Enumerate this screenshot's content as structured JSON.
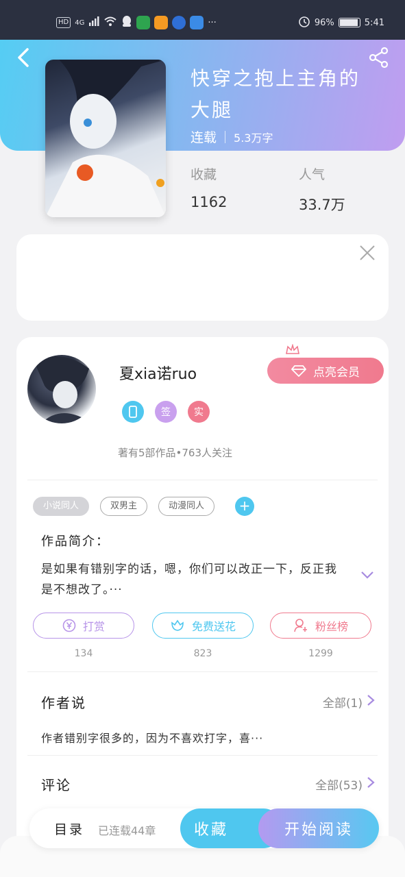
{
  "status_bar": {
    "hd": "HD",
    "network": "4G",
    "more": "···",
    "battery_text": "96%",
    "battery_level": 0.96,
    "time": "5:41"
  },
  "book": {
    "title": "快穿之抱上主角的大腿",
    "status": "连载",
    "word_count": "5.3万字",
    "collect_label": "收藏",
    "collect_value": "1162",
    "popularity_label": "人气",
    "popularity_value": "33.7万"
  },
  "author": {
    "name": "夏xia诺ruo",
    "badges": [
      {
        "icon": "phone-badge-icon",
        "text": "",
        "color": "#4fc7ef"
      },
      {
        "icon": "sign-badge-icon",
        "text": "签",
        "color": "#c9a0ee"
      },
      {
        "icon": "real-badge-icon",
        "text": "实",
        "color": "#f07a8e"
      }
    ],
    "stats": "著有5部作品•763人关注",
    "vip_label": "点亮会员"
  },
  "tags": [
    "小说同人",
    "双男主",
    "动漫同人"
  ],
  "intro": {
    "title": "作品简介：",
    "text": "是如果有错别字的话，嗯，你们可以改正一下，反正我是不想改了。···"
  },
  "actions": [
    {
      "label": "打赏",
      "count": "134",
      "color": "#b794e8",
      "icon": "yen-icon"
    },
    {
      "label": "免费送花",
      "count": "823",
      "color": "#4fc7ef",
      "icon": "flower-icon"
    },
    {
      "label": "粉丝榜",
      "count": "1299",
      "color": "#f07a8e",
      "icon": "fan-icon"
    }
  ],
  "author_says": {
    "title": "作者说",
    "more": "全部(1)",
    "text": "作者错别字很多的，因为不喜欢打字，喜···"
  },
  "comments": {
    "title": "评论",
    "more": "全部(53)"
  },
  "bottom": {
    "toc": "目录",
    "toc_sub": "已连载44章",
    "collect": "收藏",
    "start_reading": "开始阅读"
  }
}
